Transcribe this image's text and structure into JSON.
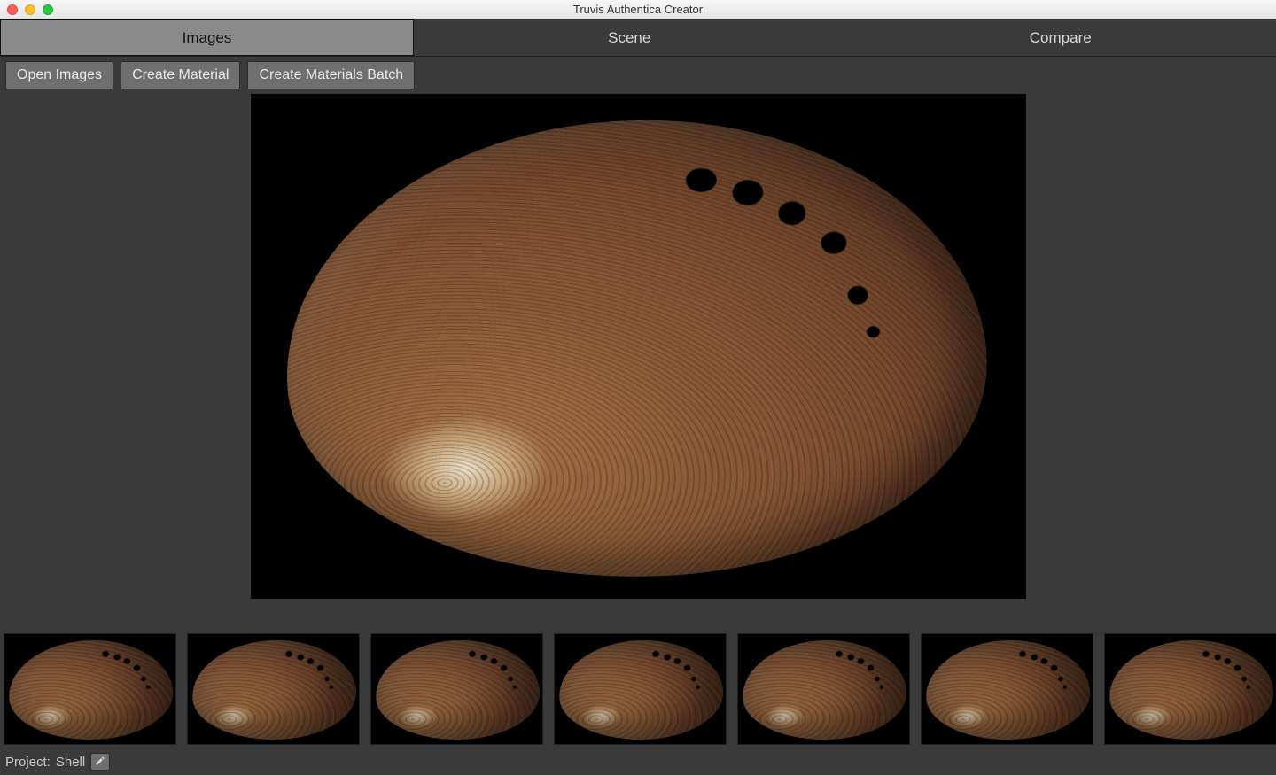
{
  "window": {
    "title": "Truvis Authentica Creator"
  },
  "tabs": {
    "images": "Images",
    "scene": "Scene",
    "compare": "Compare",
    "active": "images"
  },
  "toolbar": {
    "open_images": "Open Images",
    "create_material": "Create Material",
    "create_materials_batch": "Create Materials Batch"
  },
  "thumbnails": {
    "count": 7
  },
  "status": {
    "project_label": "Project:",
    "project_name": "Shell"
  }
}
